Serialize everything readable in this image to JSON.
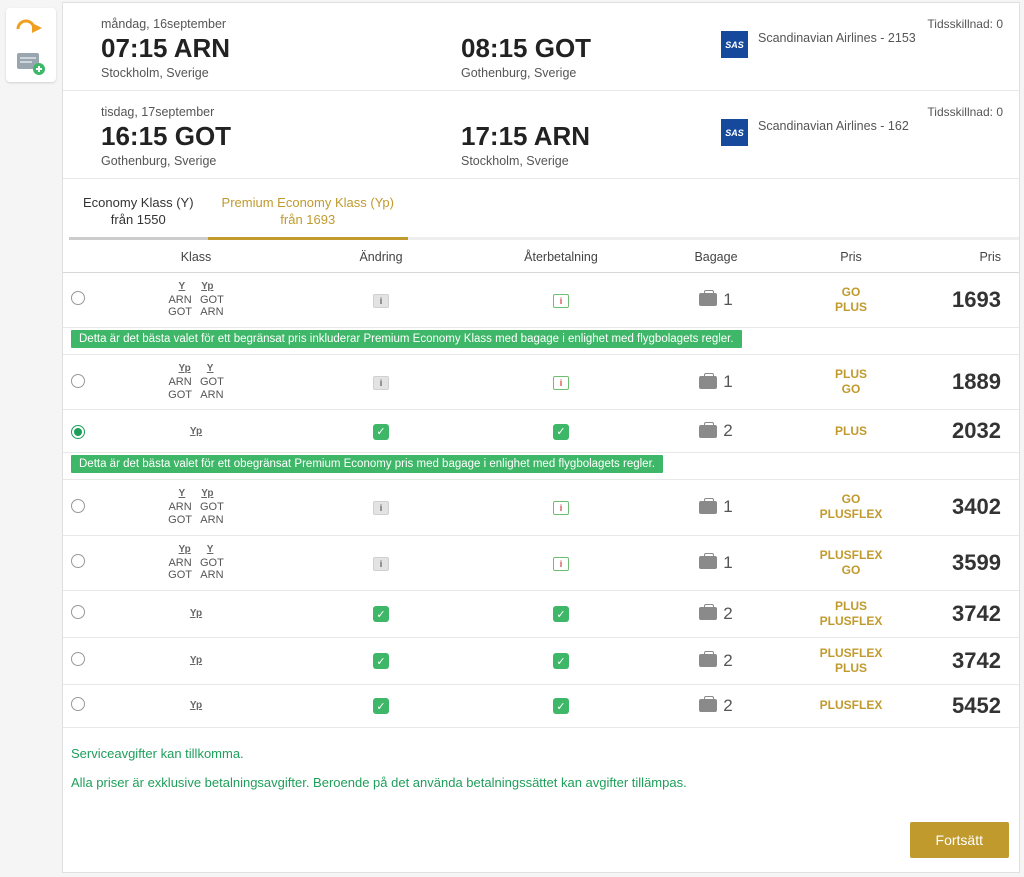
{
  "segments": [
    {
      "date_label": "måndag, 16september",
      "dep_time": "07:15",
      "dep_code": "ARN",
      "dep_city": "Stockholm, Sverige",
      "arr_time": "08:15",
      "arr_code": "GOT",
      "arr_city": "Gothenburg, Sverige",
      "carrier_badge": "SAS",
      "carrier": "Scandinavian Airlines - 2153",
      "timediff_label": "Tidsskillnad: 0"
    },
    {
      "date_label": "tisdag, 17september",
      "dep_time": "16:15",
      "dep_code": "GOT",
      "dep_city": "Gothenburg, Sverige",
      "arr_time": "17:15",
      "arr_code": "ARN",
      "arr_city": "Stockholm, Sverige",
      "carrier_badge": "SAS",
      "carrier": "Scandinavian Airlines - 162",
      "timediff_label": "Tidsskillnad: 0"
    }
  ],
  "tabs": [
    {
      "line1": "Economy Klass (Y)",
      "line2": "från 1550",
      "active": false
    },
    {
      "line1": "Premium Economy Klass (Yp)",
      "line2": "från 1693",
      "active": true
    }
  ],
  "headers": {
    "klass": "Klass",
    "andring": "Ändring",
    "ater": "Återbetalning",
    "bagage": "Bagage",
    "pris1": "Pris",
    "pris2": "Pris"
  },
  "rows": [
    {
      "selected": false,
      "klass_badges": [
        "Y",
        "Yp"
      ],
      "legs": [
        [
          "ARN",
          "GOT"
        ],
        [
          "GOT",
          "ARN"
        ]
      ],
      "andring": "info",
      "ater": "info-red",
      "bag": "1",
      "fares": [
        "GO",
        "PLUS"
      ],
      "price": "1693",
      "note": "Detta är det bästa valet för ett begränsat pris inkluderar Premium Economy Klass med bagage i enlighet med flygbolagets regler."
    },
    {
      "selected": false,
      "klass_badges": [
        "Yp",
        "Y"
      ],
      "legs": [
        [
          "ARN",
          "GOT"
        ],
        [
          "GOT",
          "ARN"
        ]
      ],
      "andring": "info",
      "ater": "info-red",
      "bag": "1",
      "fares": [
        "PLUS",
        "GO"
      ],
      "price": "1889"
    },
    {
      "selected": true,
      "klass_badges": [
        "Yp"
      ],
      "legs": [],
      "andring": "check",
      "ater": "check",
      "bag": "2",
      "fares": [
        "PLUS"
      ],
      "price": "2032",
      "note": "Detta är det bästa valet för ett obegränsat Premium Economy pris med bagage i enlighet med flygbolagets regler."
    },
    {
      "selected": false,
      "klass_badges": [
        "Y",
        "Yp"
      ],
      "legs": [
        [
          "ARN",
          "GOT"
        ],
        [
          "GOT",
          "ARN"
        ]
      ],
      "andring": "info",
      "ater": "info-red",
      "bag": "1",
      "fares": [
        "GO",
        "PLUSFLEX"
      ],
      "price": "3402"
    },
    {
      "selected": false,
      "klass_badges": [
        "Yp",
        "Y"
      ],
      "legs": [
        [
          "ARN",
          "GOT"
        ],
        [
          "GOT",
          "ARN"
        ]
      ],
      "andring": "info",
      "ater": "info-red",
      "bag": "1",
      "fares": [
        "PLUSFLEX",
        "GO"
      ],
      "price": "3599"
    },
    {
      "selected": false,
      "klass_badges": [
        "Yp"
      ],
      "legs": [],
      "andring": "check",
      "ater": "check",
      "bag": "2",
      "fares": [
        "PLUS",
        "PLUSFLEX"
      ],
      "price": "3742"
    },
    {
      "selected": false,
      "klass_badges": [
        "Yp"
      ],
      "legs": [],
      "andring": "check",
      "ater": "check",
      "bag": "2",
      "fares": [
        "PLUSFLEX",
        "PLUS"
      ],
      "price": "3742"
    },
    {
      "selected": false,
      "klass_badges": [
        "Yp"
      ],
      "legs": [],
      "andring": "check",
      "ater": "check",
      "bag": "2",
      "fares": [
        "PLUSFLEX"
      ],
      "price": "5452"
    }
  ],
  "footnotes": {
    "a": "Serviceavgifter kan tillkomma.",
    "b": "Alla priser är exklusive betalningsavgifter. Beroende på det använda betalningssättet kan avgifter tillämpas."
  },
  "buttons": {
    "continue": "Fortsätt"
  }
}
